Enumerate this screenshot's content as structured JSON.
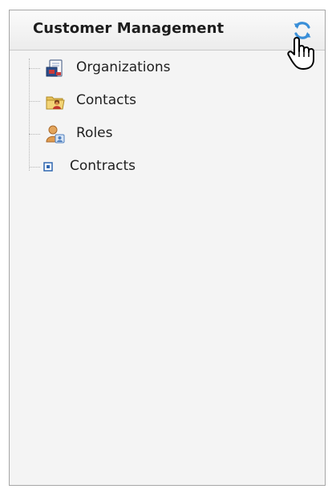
{
  "panel": {
    "title": "Customer Management",
    "refresh_icon": "refresh-icon",
    "cursor_icon": "hand-pointer-icon"
  },
  "tree": {
    "items": [
      {
        "label": "Organizations",
        "icon": "organization-document-icon"
      },
      {
        "label": "Contacts",
        "icon": "contacts-folder-icon"
      },
      {
        "label": "Roles",
        "icon": "roles-user-icon"
      },
      {
        "label": "Contracts",
        "icon": "contract-node-icon"
      }
    ]
  },
  "colors": {
    "accent_refresh": "#3a8fd8",
    "panel_bg": "#f4f4f4",
    "border": "#a6a6a6"
  }
}
